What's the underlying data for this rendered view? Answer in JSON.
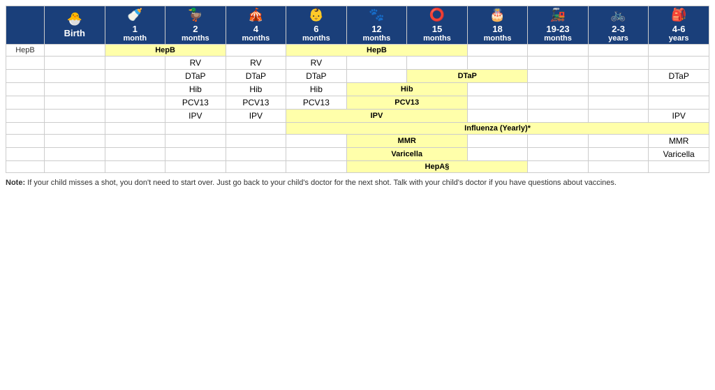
{
  "header": {
    "columns": [
      {
        "age_main": "Birth",
        "age_sub": "",
        "icon": "🐣"
      },
      {
        "age_main": "1",
        "age_sub": "month",
        "icon": "🍼"
      },
      {
        "age_main": "2",
        "age_sub": "months",
        "icon": "🦆"
      },
      {
        "age_main": "4",
        "age_sub": "months",
        "icon": "🎪"
      },
      {
        "age_main": "6",
        "age_sub": "months",
        "icon": "👶"
      },
      {
        "age_main": "12",
        "age_sub": "months",
        "icon": "🐾"
      },
      {
        "age_main": "15",
        "age_sub": "months",
        "icon": "⭕"
      },
      {
        "age_main": "18",
        "age_sub": "months",
        "icon": "🎂"
      },
      {
        "age_main": "19-23",
        "age_sub": "months",
        "icon": "🚂"
      },
      {
        "age_main": "2-3",
        "age_sub": "years",
        "icon": "🚲"
      },
      {
        "age_main": "4-6",
        "age_sub": "years",
        "icon": "🎒"
      }
    ]
  },
  "rows": [
    {
      "vaccine": "HepB",
      "cells": [
        {
          "col": 0,
          "label": "",
          "yellow": false
        },
        {
          "col": 1,
          "colspan": 2,
          "label": "HepB",
          "yellow": true
        },
        {
          "col": 3,
          "label": "",
          "yellow": false
        },
        {
          "col": 4,
          "colspan": 3,
          "label": "HepB",
          "yellow": true
        },
        {
          "col": 7,
          "label": "",
          "yellow": false
        },
        {
          "col": 8,
          "label": "",
          "yellow": false
        },
        {
          "col": 9,
          "label": "",
          "yellow": false
        },
        {
          "col": 10,
          "label": "",
          "yellow": false
        }
      ]
    },
    {
      "vaccine": "",
      "cells": [
        {
          "col": 0,
          "label": "",
          "yellow": false
        },
        {
          "col": 1,
          "label": "",
          "yellow": false
        },
        {
          "col": 2,
          "label": "RV",
          "yellow": false
        },
        {
          "col": 3,
          "label": "RV",
          "yellow": false
        },
        {
          "col": 4,
          "label": "RV",
          "yellow": false
        },
        {
          "col": 5,
          "label": "",
          "yellow": false
        },
        {
          "col": 6,
          "label": "",
          "yellow": false
        },
        {
          "col": 7,
          "label": "",
          "yellow": false
        },
        {
          "col": 8,
          "label": "",
          "yellow": false
        },
        {
          "col": 9,
          "label": "",
          "yellow": false
        },
        {
          "col": 10,
          "label": "",
          "yellow": false
        }
      ]
    },
    {
      "vaccine": "",
      "cells": [
        {
          "col": 0,
          "label": "",
          "yellow": false
        },
        {
          "col": 1,
          "label": "",
          "yellow": false
        },
        {
          "col": 2,
          "label": "DTaP",
          "yellow": false
        },
        {
          "col": 3,
          "label": "DTaP",
          "yellow": false
        },
        {
          "col": 4,
          "label": "DTaP",
          "yellow": false
        },
        {
          "col": 5,
          "label": "",
          "yellow": false
        },
        {
          "col": 6,
          "colspan": 2,
          "label": "DTaP",
          "yellow": true
        },
        {
          "col": 8,
          "label": "",
          "yellow": false
        },
        {
          "col": 9,
          "label": "",
          "yellow": false
        },
        {
          "col": 10,
          "label": "DTaP",
          "yellow": false
        }
      ]
    },
    {
      "vaccine": "",
      "cells": [
        {
          "col": 0,
          "label": "",
          "yellow": false
        },
        {
          "col": 1,
          "label": "",
          "yellow": false
        },
        {
          "col": 2,
          "label": "Hib",
          "yellow": false
        },
        {
          "col": 3,
          "label": "Hib",
          "yellow": false
        },
        {
          "col": 4,
          "label": "Hib",
          "yellow": false
        },
        {
          "col": 5,
          "colspan": 2,
          "label": "Hib",
          "yellow": true
        },
        {
          "col": 7,
          "label": "",
          "yellow": false
        },
        {
          "col": 8,
          "label": "",
          "yellow": false
        },
        {
          "col": 9,
          "label": "",
          "yellow": false
        },
        {
          "col": 10,
          "label": "",
          "yellow": false
        }
      ]
    },
    {
      "vaccine": "",
      "cells": [
        {
          "col": 0,
          "label": "",
          "yellow": false
        },
        {
          "col": 1,
          "label": "",
          "yellow": false
        },
        {
          "col": 2,
          "label": "PCV13",
          "yellow": false
        },
        {
          "col": 3,
          "label": "PCV13",
          "yellow": false
        },
        {
          "col": 4,
          "label": "PCV13",
          "yellow": false
        },
        {
          "col": 5,
          "colspan": 2,
          "label": "PCV13",
          "yellow": true
        },
        {
          "col": 7,
          "label": "",
          "yellow": false
        },
        {
          "col": 8,
          "label": "",
          "yellow": false
        },
        {
          "col": 9,
          "label": "",
          "yellow": false
        },
        {
          "col": 10,
          "label": "",
          "yellow": false
        }
      ]
    },
    {
      "vaccine": "",
      "cells": [
        {
          "col": 0,
          "label": "",
          "yellow": false
        },
        {
          "col": 1,
          "label": "",
          "yellow": false
        },
        {
          "col": 2,
          "label": "IPV",
          "yellow": false
        },
        {
          "col": 3,
          "label": "IPV",
          "yellow": false
        },
        {
          "col": 4,
          "colspan": 3,
          "label": "IPV",
          "yellow": true
        },
        {
          "col": 7,
          "label": "",
          "yellow": false
        },
        {
          "col": 8,
          "label": "",
          "yellow": false
        },
        {
          "col": 9,
          "label": "",
          "yellow": false
        },
        {
          "col": 10,
          "label": "IPV",
          "yellow": false
        }
      ]
    },
    {
      "vaccine": "",
      "cells": [
        {
          "col": 0,
          "label": "",
          "yellow": false
        },
        {
          "col": 1,
          "label": "",
          "yellow": false
        },
        {
          "col": 2,
          "label": "",
          "yellow": false
        },
        {
          "col": 3,
          "label": "",
          "yellow": false
        },
        {
          "col": 4,
          "colspan": 7,
          "label": "Influenza (Yearly)*",
          "yellow": true
        }
      ]
    },
    {
      "vaccine": "",
      "cells": [
        {
          "col": 0,
          "label": "",
          "yellow": false
        },
        {
          "col": 1,
          "label": "",
          "yellow": false
        },
        {
          "col": 2,
          "label": "",
          "yellow": false
        },
        {
          "col": 3,
          "label": "",
          "yellow": false
        },
        {
          "col": 4,
          "label": "",
          "yellow": false
        },
        {
          "col": 5,
          "colspan": 2,
          "label": "MMR",
          "yellow": true
        },
        {
          "col": 7,
          "label": "",
          "yellow": false
        },
        {
          "col": 8,
          "label": "",
          "yellow": false
        },
        {
          "col": 9,
          "label": "",
          "yellow": false
        },
        {
          "col": 10,
          "label": "MMR",
          "yellow": false
        }
      ]
    },
    {
      "vaccine": "",
      "cells": [
        {
          "col": 0,
          "label": "",
          "yellow": false
        },
        {
          "col": 1,
          "label": "",
          "yellow": false
        },
        {
          "col": 2,
          "label": "",
          "yellow": false
        },
        {
          "col": 3,
          "label": "",
          "yellow": false
        },
        {
          "col": 4,
          "label": "",
          "yellow": false
        },
        {
          "col": 5,
          "colspan": 2,
          "label": "Varicella",
          "yellow": true
        },
        {
          "col": 7,
          "label": "",
          "yellow": false
        },
        {
          "col": 8,
          "label": "",
          "yellow": false
        },
        {
          "col": 9,
          "label": "",
          "yellow": false
        },
        {
          "col": 10,
          "label": "Varicella",
          "yellow": false
        }
      ]
    },
    {
      "vaccine": "",
      "cells": [
        {
          "col": 0,
          "label": "",
          "yellow": false
        },
        {
          "col": 1,
          "label": "",
          "yellow": false
        },
        {
          "col": 2,
          "label": "",
          "yellow": false
        },
        {
          "col": 3,
          "label": "",
          "yellow": false
        },
        {
          "col": 4,
          "label": "",
          "yellow": false
        },
        {
          "col": 5,
          "colspan": 3,
          "label": "HepA§",
          "yellow": true
        },
        {
          "col": 8,
          "label": "",
          "yellow": false
        },
        {
          "col": 9,
          "label": "",
          "yellow": false
        },
        {
          "col": 10,
          "label": "",
          "yellow": false
        }
      ]
    }
  ],
  "vaccine_labels": [
    "HepB",
    "",
    "",
    "",
    "",
    "",
    "",
    "",
    "",
    ""
  ],
  "note": "Note: If your child misses a shot, you don't need to start over. Just go back to your child's doctor for the next shot. Talk with your child's doctor if you have questions about vaccines.",
  "icons": {
    "birth": "🐣",
    "1month": "🍼",
    "2months": "🦆",
    "4months": "🎪",
    "6months": "👶",
    "12months": "🐾",
    "15months": "⭕",
    "18months": "🎂",
    "19_23months": "🚂",
    "2_3years": "🚲",
    "4_6years": "🎒"
  }
}
